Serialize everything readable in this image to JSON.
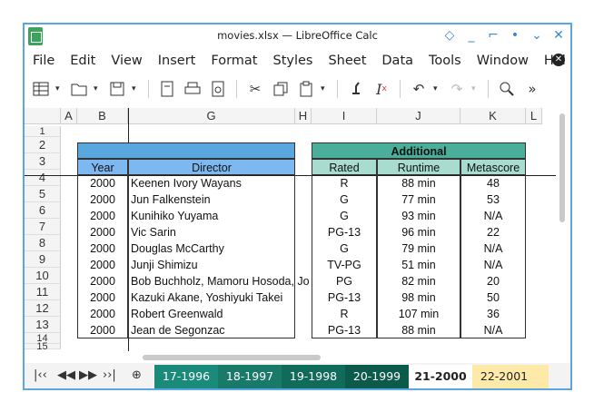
{
  "window": {
    "title": "movies.xlsx — LibreOffice Calc",
    "buttons": [
      "◇",
      "_",
      "⌐",
      "•",
      "⌄",
      "✕"
    ]
  },
  "menu": {
    "items": [
      "File",
      "Edit",
      "View",
      "Insert",
      "Format",
      "Styles",
      "Sheet",
      "Data",
      "Tools",
      "Window",
      "Hel"
    ]
  },
  "toolbar": {
    "icons": [
      "table-grid-icon",
      "folder-open-icon",
      "save-icon",
      "export-pdf-icon",
      "print-icon",
      "print-preview-icon",
      "cut-icon",
      "copy-icon",
      "paste-icon",
      "clone-formatting-icon",
      "clear-formatting-icon",
      "undo-icon",
      "redo-icon",
      "find-icon",
      "more-icon"
    ]
  },
  "columns": [
    "A",
    "B",
    "G",
    "H",
    "I",
    "J",
    "K",
    "L"
  ],
  "rows": [
    "1",
    "2",
    "3",
    "4",
    "5",
    "6",
    "7",
    "8",
    "9",
    "10",
    "11",
    "12",
    "13",
    "14",
    "15"
  ],
  "table": {
    "group_header": "Additional",
    "headers": {
      "year": "Year",
      "director": "Director",
      "rated": "Rated",
      "runtime": "Runtime",
      "metascore": "Metascore"
    },
    "records": [
      {
        "year": "2000",
        "director": "Keenen Ivory Wayans",
        "rated": "R",
        "runtime": "88 min",
        "metascore": "48"
      },
      {
        "year": "2000",
        "director": "Jun Falkenstein",
        "rated": "G",
        "runtime": "77 min",
        "metascore": "53"
      },
      {
        "year": "2000",
        "director": "Kunihiko Yuyama",
        "rated": "G",
        "runtime": "93 min",
        "metascore": "N/A"
      },
      {
        "year": "2000",
        "director": "Vic Sarin",
        "rated": "PG-13",
        "runtime": "96 min",
        "metascore": "22"
      },
      {
        "year": "2000",
        "director": "Douglas McCarthy",
        "rated": "G",
        "runtime": "79 min",
        "metascore": "N/A"
      },
      {
        "year": "2000",
        "director": "Junji Shimizu",
        "rated": "TV-PG",
        "runtime": "51 min",
        "metascore": "N/A"
      },
      {
        "year": "2000",
        "director": "Bob Buchholz, Mamoru Hosoda, Jo",
        "rated": "PG",
        "runtime": "82 min",
        "metascore": "20"
      },
      {
        "year": "2000",
        "director": "Kazuki Akane, Yoshiyuki Takei",
        "rated": "PG-13",
        "runtime": "98 min",
        "metascore": "50"
      },
      {
        "year": "2000",
        "director": "Robert Greenwald",
        "rated": "R",
        "runtime": "107 min",
        "metascore": "36"
      },
      {
        "year": "2000",
        "director": "Jean de Segonzac",
        "rated": "PG-13",
        "runtime": "88 min",
        "metascore": "N/A"
      }
    ]
  },
  "sheet_tabs": [
    {
      "label": "17-1996",
      "color": "#1a8a7a",
      "active": false
    },
    {
      "label": "18-1997",
      "color": "#1a7a6a",
      "active": false
    },
    {
      "label": "19-1998",
      "color": "#116b5b",
      "active": false
    },
    {
      "label": "20-1999",
      "color": "#0b5a4a",
      "active": false
    },
    {
      "label": "21-2000",
      "color": "#ffffff",
      "active": true
    },
    {
      "label": "22-2001",
      "color": "#fde9a8",
      "active": false
    }
  ],
  "colors": {
    "blue_header": "#7db8f0",
    "teal_header": "#5bbba7",
    "teal_light": "#a7dccf",
    "accent": "#5aa6de"
  }
}
